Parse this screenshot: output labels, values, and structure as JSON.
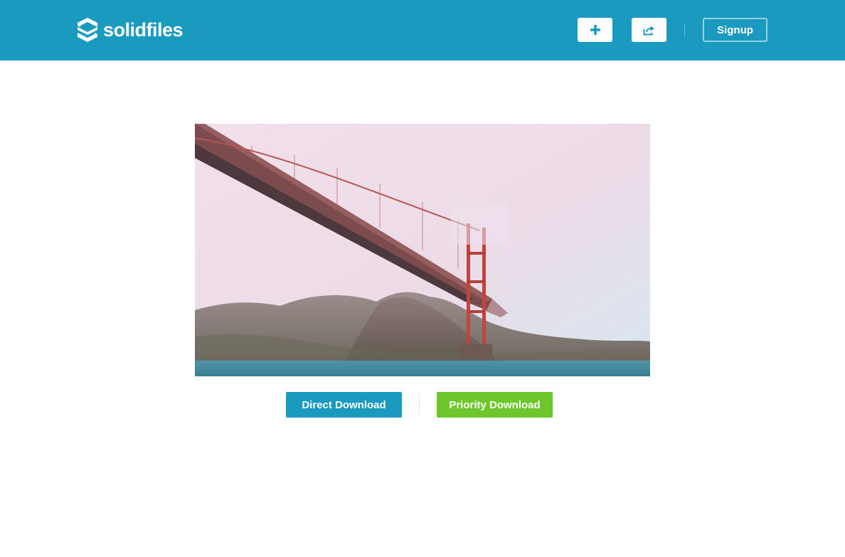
{
  "brand": {
    "name": "solidfiles",
    "logo_icon": "solidfiles-s-logo-icon",
    "color": "#1b9ac0"
  },
  "header": {
    "add_icon": "plus-icon",
    "share_icon": "share-icon",
    "signup_label": "Signup"
  },
  "preview": {
    "subject": "Golden Gate Bridge over water"
  },
  "downloads": {
    "direct_label": "Direct Download",
    "direct_color": "#1b9ac0",
    "priority_label": "Priority Download",
    "priority_color": "#6cc82a"
  }
}
